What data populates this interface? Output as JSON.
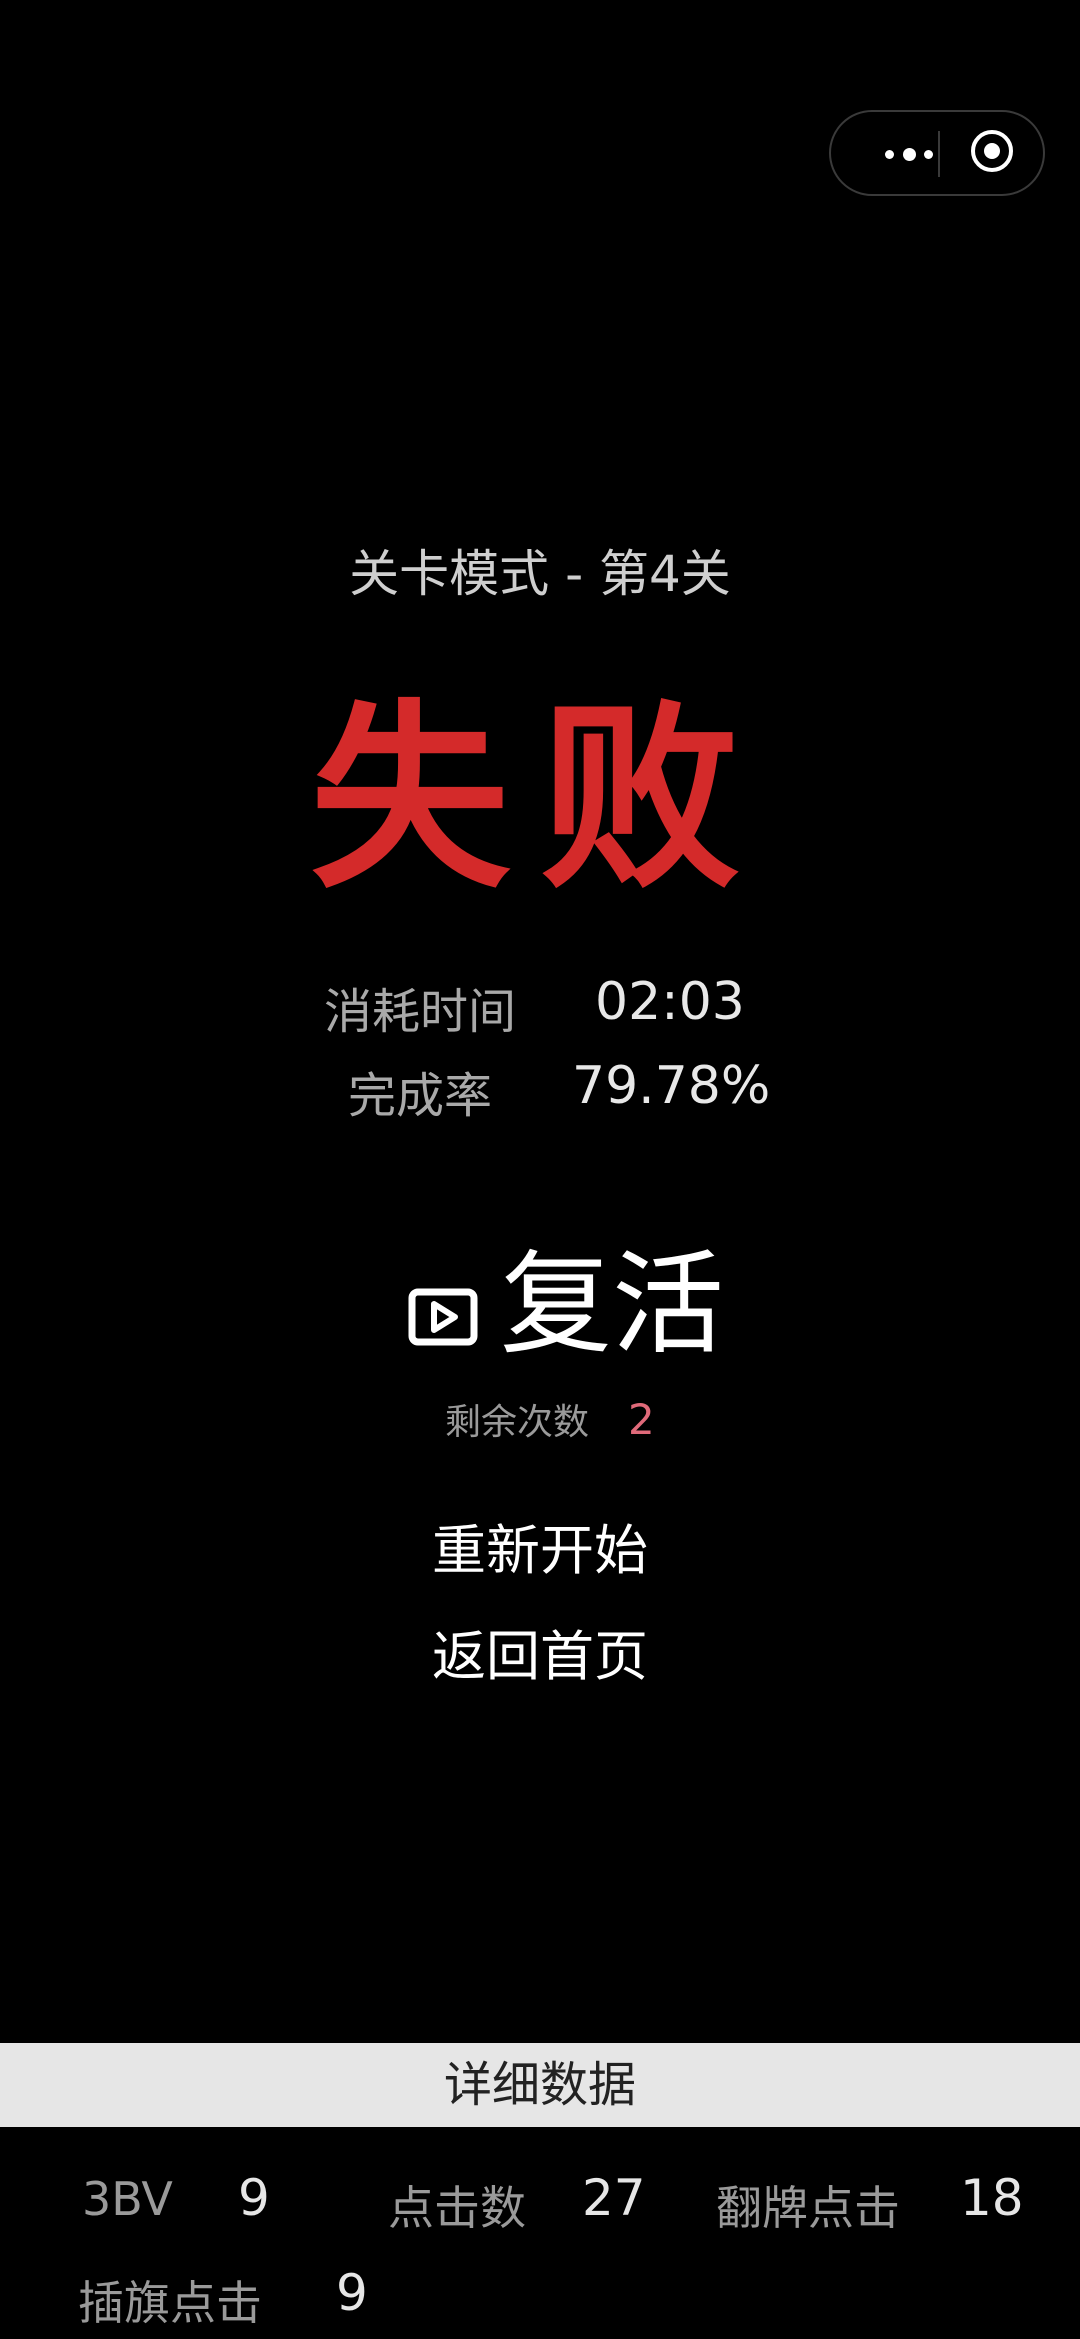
{
  "capsule": {
    "more_icon": "more-dots-icon",
    "close_icon": "target-close-icon"
  },
  "game": {
    "level_title": "关卡模式 - 第4关",
    "result": "失败"
  },
  "stats": {
    "time_label": "消耗时间",
    "time_value": "02:03",
    "rate_label": "完成率",
    "rate_value": "79.78%"
  },
  "revive": {
    "icon": "video-play-icon",
    "label": "复活",
    "remaining_label": "剩余次数",
    "remaining_value": "2"
  },
  "menu": {
    "restart": "重新开始",
    "home": "返回首页"
  },
  "details": {
    "header": "详细数据",
    "items": [
      {
        "label": "3BV",
        "value": "9"
      },
      {
        "label": "点击数",
        "value": "27"
      },
      {
        "label": "翻牌点击",
        "value": "18"
      },
      {
        "label": "插旗点击",
        "value": "9"
      }
    ]
  },
  "colors": {
    "background": "#000000",
    "fail_red": "#d42a2a",
    "remaining_pink": "#e06a7a",
    "detail_bar": "#e6e6e6"
  }
}
